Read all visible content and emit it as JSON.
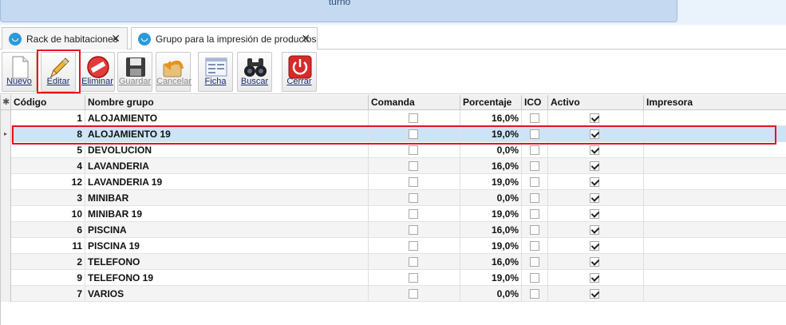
{
  "topbar": {
    "label": "turno"
  },
  "tabs": [
    {
      "label": "Rack de habitaciones",
      "close": "✕",
      "active": false
    },
    {
      "label": "Grupo para la impresión de productos",
      "close": "✕",
      "active": true
    }
  ],
  "toolbar": {
    "buttons": [
      {
        "id": "nuevo",
        "label": "Nuevo",
        "icon": "new-document-icon",
        "enabled": true
      },
      {
        "id": "editar",
        "label": "Editar",
        "icon": "pencil-icon",
        "enabled": true
      },
      {
        "id": "eliminar",
        "label": "Eliminar",
        "icon": "no-entry-icon",
        "enabled": true
      },
      {
        "id": "guardar",
        "label": "Guardar",
        "icon": "floppy-disk-icon",
        "enabled": false
      },
      {
        "id": "cancelar",
        "label": "Cancelar",
        "icon": "undo-arrow-icon",
        "enabled": false
      },
      {
        "id": "ficha",
        "label": "Ficha",
        "icon": "form-card-icon",
        "enabled": true
      },
      {
        "id": "buscar",
        "label": "Buscar",
        "icon": "binoculars-icon",
        "enabled": true
      },
      {
        "id": "cerrar",
        "label": "Cerrar",
        "icon": "power-icon",
        "enabled": true
      }
    ]
  },
  "grid": {
    "new_row_marker": "✱",
    "current_row_marker": "▸",
    "columns": [
      "Código",
      "Nombre grupo",
      "Comanda",
      "Porcentaje",
      "ICO",
      "Activo",
      "Impresora"
    ],
    "rows": [
      {
        "codigo": "1",
        "nombre": "ALOJAMIENTO",
        "comanda": false,
        "porcentaje": "16,0%",
        "ico": false,
        "activo": true,
        "impresora": ""
      },
      {
        "codigo": "8",
        "nombre": "ALOJAMIENTO 19",
        "comanda": false,
        "porcentaje": "19,0%",
        "ico": false,
        "activo": true,
        "impresora": ""
      },
      {
        "codigo": "5",
        "nombre": "DEVOLUCION",
        "comanda": false,
        "porcentaje": "0,0%",
        "ico": false,
        "activo": true,
        "impresora": ""
      },
      {
        "codigo": "4",
        "nombre": "LAVANDERIA",
        "comanda": false,
        "porcentaje": "16,0%",
        "ico": false,
        "activo": true,
        "impresora": ""
      },
      {
        "codigo": "12",
        "nombre": "LAVANDERIA 19",
        "comanda": false,
        "porcentaje": "19,0%",
        "ico": false,
        "activo": true,
        "impresora": ""
      },
      {
        "codigo": "3",
        "nombre": "MINIBAR",
        "comanda": false,
        "porcentaje": "0,0%",
        "ico": false,
        "activo": true,
        "impresora": ""
      },
      {
        "codigo": "10",
        "nombre": "MINIBAR 19",
        "comanda": false,
        "porcentaje": "19,0%",
        "ico": false,
        "activo": true,
        "impresora": ""
      },
      {
        "codigo": "6",
        "nombre": "PISCINA",
        "comanda": false,
        "porcentaje": "16,0%",
        "ico": false,
        "activo": true,
        "impresora": ""
      },
      {
        "codigo": "11",
        "nombre": "PISCINA 19",
        "comanda": false,
        "porcentaje": "19,0%",
        "ico": false,
        "activo": true,
        "impresora": ""
      },
      {
        "codigo": "2",
        "nombre": "TELEFONO",
        "comanda": false,
        "porcentaje": "16,0%",
        "ico": false,
        "activo": true,
        "impresora": ""
      },
      {
        "codigo": "9",
        "nombre": "TELEFONO 19",
        "comanda": false,
        "porcentaje": "19,0%",
        "ico": false,
        "activo": true,
        "impresora": ""
      },
      {
        "codigo": "7",
        "nombre": "VARIOS",
        "comanda": false,
        "porcentaje": "0,0%",
        "ico": false,
        "activo": true,
        "impresora": ""
      }
    ],
    "selected_row": 1
  },
  "colors": {
    "highlight": "#e8131b",
    "selection": "#cfe3f7",
    "tab_icon": "#2b9ad8"
  }
}
